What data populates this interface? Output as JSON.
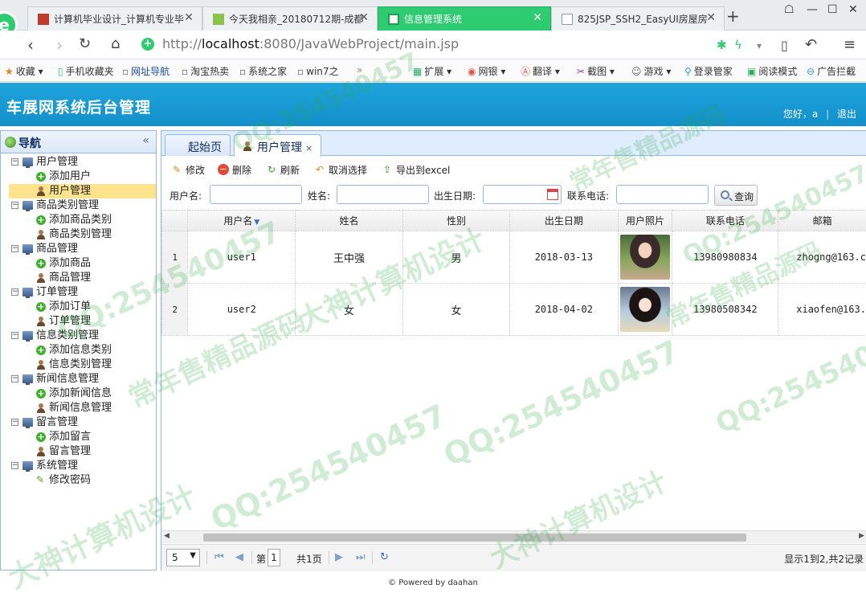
{
  "browser": {
    "tabs": [
      {
        "title": "计算机毕业设计_计算机专业毕",
        "favicon_color": "#c0392b",
        "active": false
      },
      {
        "title": "今天我相亲_20180712期-成都",
        "favicon_color": "#8bc34a",
        "active": false
      },
      {
        "title": "信息管理系统",
        "favicon_color": "#ffffff",
        "active": true
      },
      {
        "title": "825JSP_SSH2_EasyUI房屋房",
        "favicon_color": "#999999",
        "active": false
      }
    ],
    "url_prefix": "http://",
    "url_host": "localhost",
    "url_rest": ":8080/JavaWebProject/main.jsp",
    "bookmarks": [
      "收藏",
      "手机收藏夹",
      "网址导航",
      "淘宝热卖",
      "系统之家",
      "win7之"
    ],
    "bookmarks_right": [
      "扩展",
      "网银",
      "翻译",
      "截图",
      "游戏",
      "登录管家",
      "阅读模式",
      "广告拦截"
    ]
  },
  "header": {
    "title": "车展网系统后台管理",
    "greeting": "您好，a",
    "logout": "退出"
  },
  "sidebar": {
    "title": "导航",
    "groups": [
      {
        "label": "用户管理",
        "items": [
          {
            "label": "添加用户",
            "icon": "add-icon"
          },
          {
            "label": "用户管理",
            "icon": "user-icon",
            "selected": true
          }
        ]
      },
      {
        "label": "商品类别管理",
        "items": [
          {
            "label": "添加商品类别",
            "icon": "add-icon"
          },
          {
            "label": "商品类别管理",
            "icon": "user-icon"
          }
        ]
      },
      {
        "label": "商品管理",
        "items": [
          {
            "label": "添加商品",
            "icon": "add-icon"
          },
          {
            "label": "商品管理",
            "icon": "user-icon"
          }
        ]
      },
      {
        "label": "订单管理",
        "items": [
          {
            "label": "添加订单",
            "icon": "add-icon"
          },
          {
            "label": "订单管理",
            "icon": "user-icon"
          }
        ]
      },
      {
        "label": "信息类别管理",
        "items": [
          {
            "label": "添加信息类别",
            "icon": "add-icon"
          },
          {
            "label": "信息类别管理",
            "icon": "user-icon"
          }
        ]
      },
      {
        "label": "新闻信息管理",
        "items": [
          {
            "label": "添加新闻信息",
            "icon": "add-icon"
          },
          {
            "label": "新闻信息管理",
            "icon": "user-icon"
          }
        ]
      },
      {
        "label": "留言管理",
        "items": [
          {
            "label": "添加留言",
            "icon": "add-icon"
          },
          {
            "label": "留言管理",
            "icon": "user-icon"
          }
        ]
      },
      {
        "label": "系统管理",
        "items": [
          {
            "label": "修改密码",
            "icon": "pencil-icon"
          }
        ]
      }
    ]
  },
  "main": {
    "tabs": [
      {
        "label": "起始页",
        "active": false
      },
      {
        "label": "用户管理",
        "active": true,
        "closable": true
      }
    ],
    "toolbar": {
      "edit": "修改",
      "delete": "删除",
      "refresh": "刷新",
      "unselect": "取消选择",
      "export": "导出到excel"
    },
    "search": {
      "username_label": "用户名:",
      "name_label": "姓名:",
      "birthday_label": "出生日期:",
      "phone_label": "联系电话:",
      "query_button": "查询",
      "username_value": "",
      "name_value": "",
      "birthday_value": "",
      "phone_value": ""
    },
    "grid": {
      "columns": [
        "用户名",
        "姓名",
        "性别",
        "出生日期",
        "用户照片",
        "联系电话",
        "邮箱"
      ],
      "sorted_column": "用户名",
      "rows": [
        {
          "rownum": "1",
          "username": "user1",
          "name": "王中强",
          "gender": "男",
          "birthday": "2018-03-13",
          "phone": "13980980834",
          "email": "zhogng@163.c"
        },
        {
          "rownum": "2",
          "username": "user2",
          "name": "女",
          "gender": "女",
          "birthday": "2018-04-02",
          "phone": "13980508342",
          "email": "xiaofen@163."
        }
      ]
    },
    "pager": {
      "page_size": "5",
      "page_prefix": "第",
      "page_current": "1",
      "page_total": "共1页",
      "summary": "显示1到2,共2记录"
    }
  },
  "footer": {
    "text": "© Powered by daahan"
  },
  "watermarks": [
    "QQ:254540457",
    "大神计算机设计",
    "常年售精品源码"
  ]
}
